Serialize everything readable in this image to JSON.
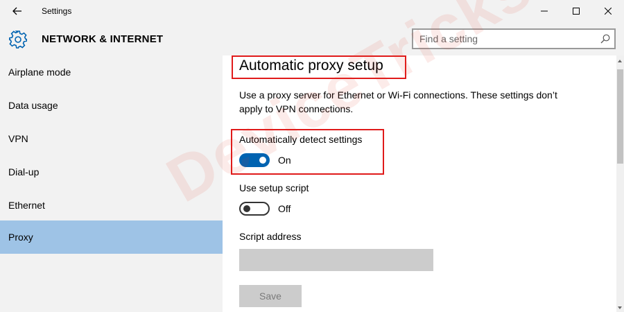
{
  "titlebar": {
    "title": "Settings",
    "back_icon": "arrow-left-icon",
    "minimize_icon": "minimize-icon",
    "maximize_icon": "maximize-icon",
    "close_icon": "close-icon"
  },
  "header": {
    "icon": "gear-icon",
    "title": "NETWORK & INTERNET",
    "search_placeholder": "Find a setting",
    "search_value": "",
    "search_icon": "search-icon"
  },
  "sidebar": {
    "items": [
      {
        "label": "Airplane mode",
        "selected": false
      },
      {
        "label": "Data usage",
        "selected": false
      },
      {
        "label": "VPN",
        "selected": false
      },
      {
        "label": "Dial-up",
        "selected": false
      },
      {
        "label": "Ethernet",
        "selected": false
      },
      {
        "label": "Proxy",
        "selected": true
      }
    ]
  },
  "main": {
    "heading": "Automatic proxy setup",
    "description": "Use a proxy server for Ethernet or Wi-Fi connections. These settings don’t apply to VPN connections.",
    "auto_detect": {
      "label": "Automatically detect settings",
      "state": "On",
      "on": true
    },
    "setup_script": {
      "label": "Use setup script",
      "state": "Off",
      "on": false
    },
    "script_address": {
      "label": "Script address",
      "value": ""
    },
    "save_label": "Save"
  },
  "watermark": "DeviceTricks",
  "colors": {
    "accent": "#0063b1",
    "selected_nav": "#9ec3e6",
    "highlight_border": "#e01a1a",
    "chrome_bg": "#f2f2f2"
  }
}
